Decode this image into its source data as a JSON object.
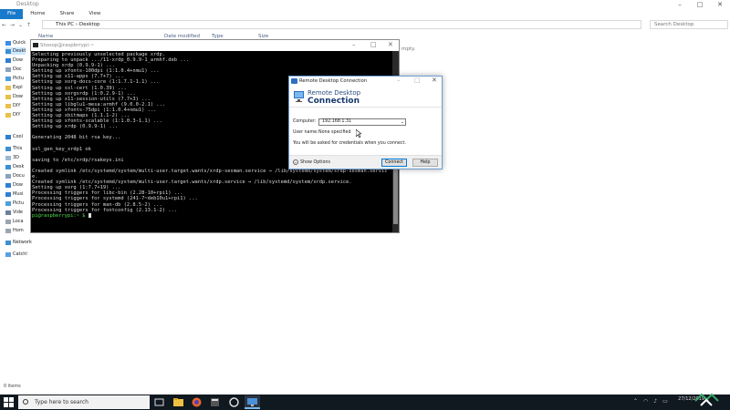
{
  "explorer": {
    "title": "Desktop",
    "tabs": [
      "File",
      "Home",
      "Share",
      "View"
    ],
    "breadcrumb": [
      "This PC",
      "Desktop"
    ],
    "search_placeholder": "Search Desktop",
    "columns": [
      "Name",
      "Date modified",
      "Type",
      "Size"
    ],
    "sidebar": [
      "Quick",
      "Deskt",
      "Dow",
      "Doc",
      "Pictu",
      "Expl",
      "Dow",
      "DIY",
      "DIY",
      "Cool",
      "This",
      "3D",
      "Desk",
      "Docu",
      "Dow",
      "Musi",
      "Pictu",
      "Vide",
      "Loca",
      "Hom",
      "Network",
      "Catchl"
    ],
    "status": "0 items",
    "empty_note": "mpty."
  },
  "terminal": {
    "title": "Stooop@raspbrrypi:~",
    "lines": [
      "Selecting previously unselected package xrdp.",
      "Preparing to unpack .../11-xrdp_0.9.9-1_armhf.deb ...",
      "Unpacking xrdp (0.9.9-1) ...",
      "Setting up xfonts-100dpi (1:1.0.4+nmu1) ...",
      "Setting up x11-apps (7.7+7) ...",
      "Setting up xorg-docs-core (1:1.7.1-1.1) ...",
      "Setting up ssl-cert (1.0.39) ...",
      "Setting up xorgxrdp (1:0.2.9-1) ...",
      "Setting up x11-session-utils (7.7+3) ...",
      "Setting up libglu1-mesa:armhf (9.0.0-2.1) ...",
      "Setting up xfonts-75dpi (1:1.0.4+nmu1) ...",
      "Setting up xbitmaps (1.1.1-2) ...",
      "Setting up xfonts-scalable (1:1.0.3-1.1) ...",
      "Setting up xrdp (0.9.9-1) ...",
      "",
      "Generating 2048 bit rsa key...",
      "",
      "ssl_gen_key_xrdp1 ok",
      "",
      "saving to /etc/xrdp/rsakeys.ini",
      "",
      "Created symlink /etc/systemd/system/multi-user.target.wants/xrdp-sesman.service → /lib/systemd/system/xrdp-sesman.servic",
      "e.",
      "Created symlink /etc/systemd/system/multi-user.target.wants/xrdp.service → /lib/systemd/system/xrdp.service.",
      "Setting up xorg (1:7.7+19) ...",
      "Processing triggers for libc-bin (2.28-10+rpi1) ...",
      "Processing triggers for systemd (241-7~deb10u1+rpi1) ...",
      "Processing triggers for man-db (2.8.5-2) ...",
      "Processing triggers for fontconfig (2.13.1-2) ..."
    ],
    "prompt": "pi@raspberrypi:~ $"
  },
  "rdp": {
    "title": "Remote Desktop Connection",
    "banner_line1": "Remote Desktop",
    "banner_line2": "Connection",
    "computer_label": "Computer:",
    "computer_value": "192.168.1.31",
    "username_label": "User name:",
    "username_value": "None specified",
    "note": "You will be asked for credentials when you connect.",
    "show_options": "Show Options",
    "connect": "Connect",
    "help": "Help"
  },
  "taskbar": {
    "search_placeholder": "Type here to search",
    "date": "27/12/2019",
    "time": ""
  },
  "colors": {
    "accent": "#1979ca",
    "taskbar": "#101820",
    "prompt_green": "#4ee24e"
  }
}
